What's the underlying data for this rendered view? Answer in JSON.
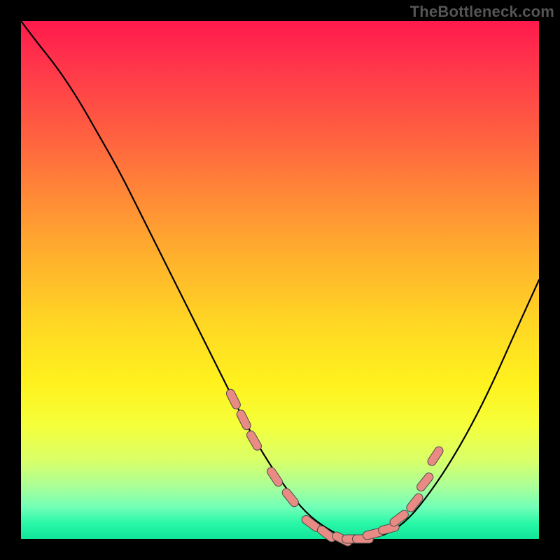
{
  "watermark": "TheBottleneck.com",
  "colors": {
    "frame": "#000000",
    "curve": "#000000",
    "marker": "#e98b84",
    "marker_stroke": "#4a4a4a"
  },
  "chart_data": {
    "type": "line",
    "title": "",
    "xlabel": "",
    "ylabel": "",
    "xlim": [
      0,
      100
    ],
    "ylim": [
      0,
      100
    ],
    "grid": false,
    "series": [
      {
        "name": "bottleneck-curve",
        "x": [
          0,
          3,
          7,
          11,
          15,
          19,
          23,
          27,
          31,
          35,
          39,
          43,
          47,
          51,
          55,
          59,
          63,
          67,
          71,
          75,
          79,
          83,
          87,
          91,
          95,
          100
        ],
        "y": [
          100,
          96,
          91,
          85,
          78,
          71,
          63,
          55,
          47,
          39,
          31,
          23,
          16,
          10,
          5,
          2,
          0,
          0,
          1,
          4,
          9,
          15,
          22,
          30,
          39,
          50
        ]
      }
    ],
    "markers": {
      "name": "highlighted-points",
      "x": [
        41,
        43,
        45,
        49,
        52,
        56,
        59,
        62,
        64,
        66,
        68,
        71,
        73,
        76,
        78,
        80
      ],
      "y": [
        27,
        23,
        19,
        12,
        8,
        3,
        1,
        0,
        0,
        0,
        1,
        2,
        4,
        7,
        11,
        16
      ]
    }
  }
}
